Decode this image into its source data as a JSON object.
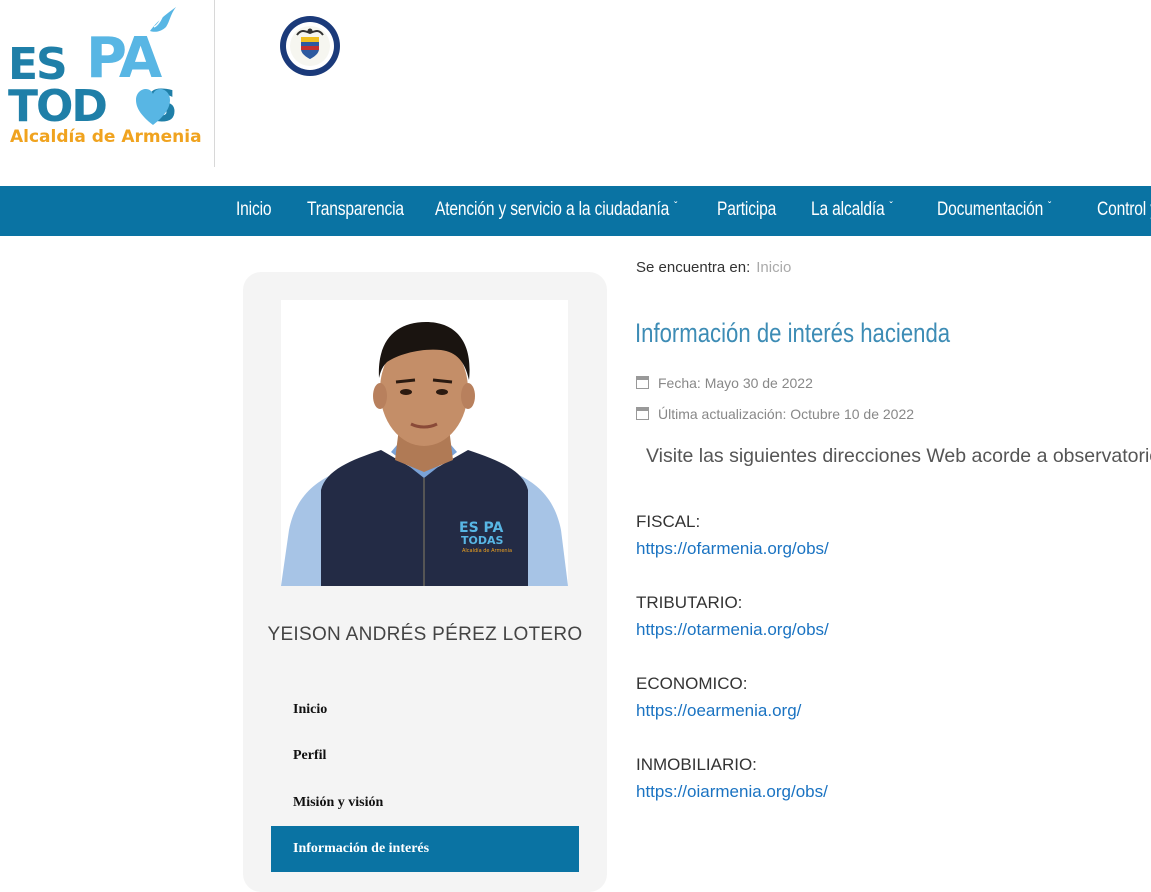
{
  "header": {
    "logo": {
      "line1_left": "ES",
      "line1_right": "PA",
      "line2": "TOD",
      "line2_end": "S",
      "subtitle": "Alcaldía de Armenia"
    },
    "seal_text": "REPÚBLICA DE COLOMBIA"
  },
  "nav": {
    "items": [
      {
        "label": "Inicio",
        "has_dropdown": false
      },
      {
        "label": "Transparencia",
        "has_dropdown": false
      },
      {
        "label": "Atención y servicio a la ciudadanía",
        "has_dropdown": true
      },
      {
        "label": "Participa",
        "has_dropdown": false
      },
      {
        "label": "La alcaldía",
        "has_dropdown": true
      },
      {
        "label": "Documentación",
        "has_dropdown": true
      },
      {
        "label": "Control y",
        "has_dropdown": false
      }
    ],
    "chevron": "ˇ"
  },
  "sidebar": {
    "person_name": "YEISON ANDRÉS PÉREZ LOTERO",
    "vest_logo": {
      "line1": "ES PA",
      "line2": "TODAS",
      "line3": "Alcaldía de Armenia"
    },
    "items": [
      {
        "label": "Inicio",
        "active": false
      },
      {
        "label": "Perfil",
        "active": false
      },
      {
        "label": "Misión y visión",
        "active": false
      },
      {
        "label": "Información de interés",
        "active": true
      }
    ]
  },
  "breadcrumb": {
    "prefix": "Se encuentra en:",
    "current": "Inicio"
  },
  "article": {
    "title": "Información de interés hacienda",
    "date": "Fecha: Mayo 30 de 2022",
    "updated": "Última actualización: Octubre 10 de 2022",
    "intro": "Visite las siguientes direcciones Web acorde a observatorios:",
    "observatories": [
      {
        "label": "FISCAL:",
        "url": "https://ofarmenia.org/obs/"
      },
      {
        "label": "TRIBUTARIO:",
        "url": "https://otarmenia.org/obs/"
      },
      {
        "label": "ECONOMICO:",
        "url": "https://oearmenia.org/"
      },
      {
        "label": "INMOBILIARIO:",
        "url": "https://oiarmenia.org/obs/"
      }
    ]
  },
  "colors": {
    "brand_blue": "#0a73a3",
    "title_blue": "#3d8cb5",
    "link_blue": "#1a73c2",
    "logo_orange": "#f0a31f",
    "logo_light_blue": "#58b6e4"
  }
}
